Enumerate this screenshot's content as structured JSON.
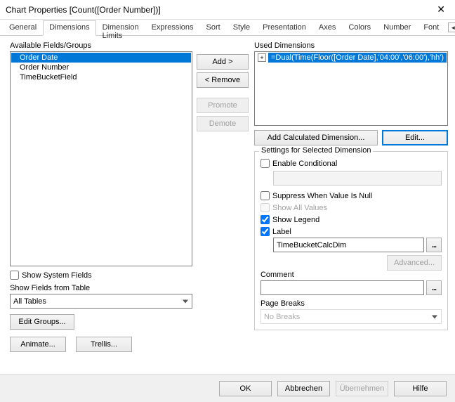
{
  "window": {
    "title": "Chart Properties [Count([Order Number])]"
  },
  "tabs": {
    "general": "General",
    "dimensions": "Dimensions",
    "dimlimits": "Dimension Limits",
    "expressions": "Expressions",
    "sort": "Sort",
    "style": "Style",
    "presentation": "Presentation",
    "axes": "Axes",
    "colors": "Colors",
    "number": "Number",
    "font": "Font"
  },
  "left": {
    "available_label": "Available Fields/Groups",
    "items": {
      "order_date": "Order Date",
      "order_number": "Order Number",
      "time_bucket": "TimeBucketField"
    },
    "show_system": "Show System Fields",
    "show_from_table": "Show Fields from Table",
    "all_tables": "All Tables",
    "edit_groups": "Edit Groups...",
    "animate": "Animate...",
    "trellis": "Trellis..."
  },
  "mid": {
    "add": "Add >",
    "remove": "< Remove",
    "promote": "Promote",
    "demote": "Demote"
  },
  "right": {
    "used_label": "Used Dimensions",
    "used_item": "=Dual(Time(Floor([Order  Date],'04:00','06:00'),'hh')",
    "add_calc": "Add Calculated Dimension...",
    "edit": "Edit...",
    "settings_legend": "Settings for Selected Dimension",
    "enable_cond": "Enable Conditional",
    "suppress_null": "Suppress When Value Is Null",
    "show_all": "Show All Values",
    "show_legend": "Show Legend",
    "label_label": "Label",
    "label_value": "TimeBucketCalcDim",
    "advanced": "Advanced...",
    "comment": "Comment",
    "page_breaks": "Page Breaks",
    "no_breaks": "No Breaks"
  },
  "footer": {
    "ok": "OK",
    "cancel": "Abbrechen",
    "apply": "Übernehmen",
    "help": "Hilfe"
  }
}
